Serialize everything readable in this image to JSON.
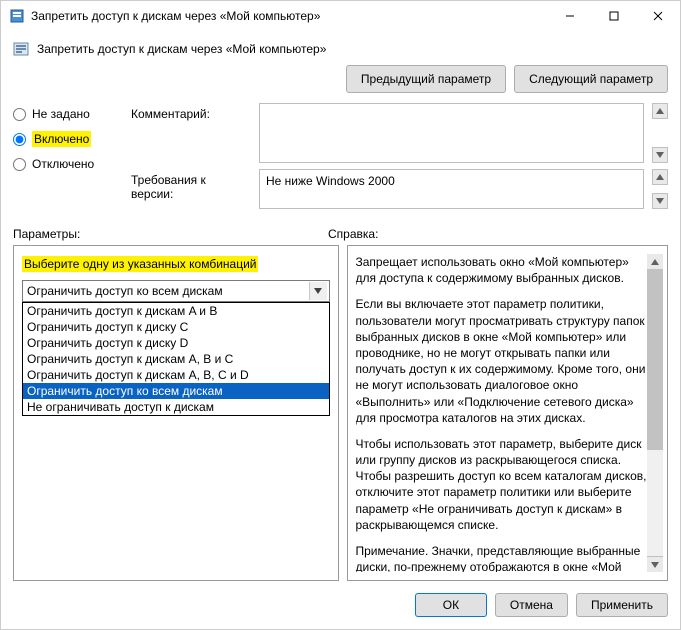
{
  "window": {
    "title": "Запретить доступ к дискам через «Мой компьютер»"
  },
  "header": {
    "title": "Запретить доступ к дискам через «Мой компьютер»",
    "prev_btn": "Предыдущий параметр",
    "next_btn": "Следующий параметр"
  },
  "state": {
    "not_configured": "Не задано",
    "enabled": "Включено",
    "disabled": "Отключено",
    "selected": "enabled"
  },
  "labels": {
    "comment": "Комментарий:",
    "supported": "Требования к версии:",
    "options": "Параметры:",
    "help": "Справка:"
  },
  "supported_on": "Не ниже Windows 2000",
  "options_panel": {
    "combo_label": "Выберите одну из указанных комбинаций",
    "combo_value": "Ограничить доступ ко всем дискам",
    "items": [
      "Ограничить доступ к дискам A и B",
      "Ограничить доступ к диску C",
      "Ограничить доступ к диску D",
      "Ограничить доступ к дискам A, B и C",
      "Ограничить доступ к дискам A, B, C и D",
      "Ограничить доступ ко всем дискам",
      "Не ограничивать доступ к дискам"
    ],
    "selected_index": 5
  },
  "help": {
    "p1": "Запрещает использовать окно «Мой компьютер» для доступа к содержимому выбранных дисков.",
    "p2": "Если вы включаете этот параметр политики, пользователи могут просматривать структуру папок выбранных дисков в окне «Мой компьютер» или проводнике, но не могут открывать папки или получать доступ к их содержимому. Кроме того, они не могут использовать диалоговое окно «Выполнить» или «Подключение сетевого диска» для просмотра каталогов на этих дисках.",
    "p3": "Чтобы использовать этот параметр, выберите диск или группу дисков из раскрывающегося списка. Чтобы разрешить доступ ко всем каталогам дисков, отключите этот параметр политики или выберите параметр «Не ограничивать доступ к дискам» в раскрывающемся списке.",
    "p4": "Примечание. Значки, представляющие выбранные диски, по-прежнему отображаются в окне «Мой компьютер», но если пользователь дважды щелкает эти значки, появляется сообщение о том, что параметр политики запрещает"
  },
  "footer": {
    "ok": "ОК",
    "cancel": "Отмена",
    "apply": "Применить"
  }
}
